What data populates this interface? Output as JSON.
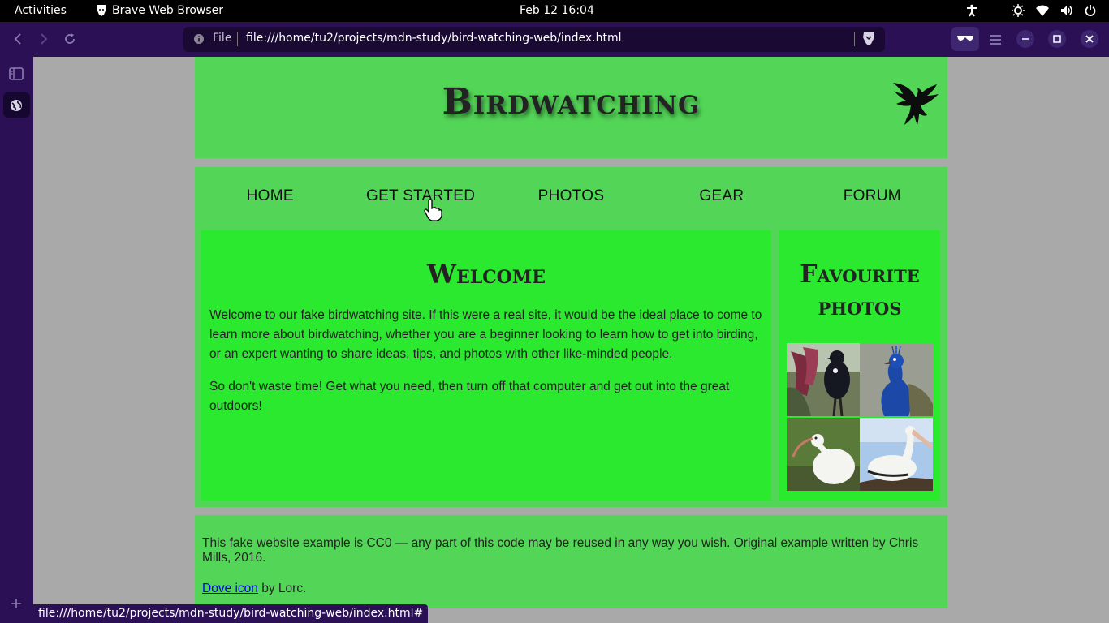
{
  "system_bar": {
    "activities": "Activities",
    "app_name": "Brave Web Browser",
    "clock": "Feb 12  16:04"
  },
  "browser": {
    "scheme_label": "File",
    "url": "file:///home/tu2/projects/mdn-study/bird-watching-web/index.html",
    "status_url": "file:///home/tu2/projects/mdn-study/bird-watching-web/index.html#"
  },
  "site": {
    "title": "Birdwatching",
    "nav": [
      "HOME",
      "GET STARTED",
      "PHOTOS",
      "GEAR",
      "FORUM"
    ],
    "article": {
      "heading": "Welcome",
      "paragraphs": [
        "Welcome to our fake birdwatching site. If this were a real site, it would be the ideal place to come to learn more about birdwatching, whether you are a beginner looking to learn how to get into birding, or an expert wanting to share ideas, tips, and photos with other like-minded people.",
        "So don't waste time! Get what you need, then turn off that computer and get out into the great outdoors!"
      ]
    },
    "aside": {
      "heading": "Favourite photos"
    },
    "footer": {
      "license": "This fake website example is CC0 — any part of this code may be reused in any way you wish. Original example written by Chris Mills, 2016.",
      "icon_link": "Dove icon",
      "credit": " by Lorc."
    }
  },
  "colors": {
    "header_green": "#53d657",
    "content_green": "#2ae92f",
    "page_gray": "#a9a9a9",
    "browser_purple": "#2b1055"
  }
}
